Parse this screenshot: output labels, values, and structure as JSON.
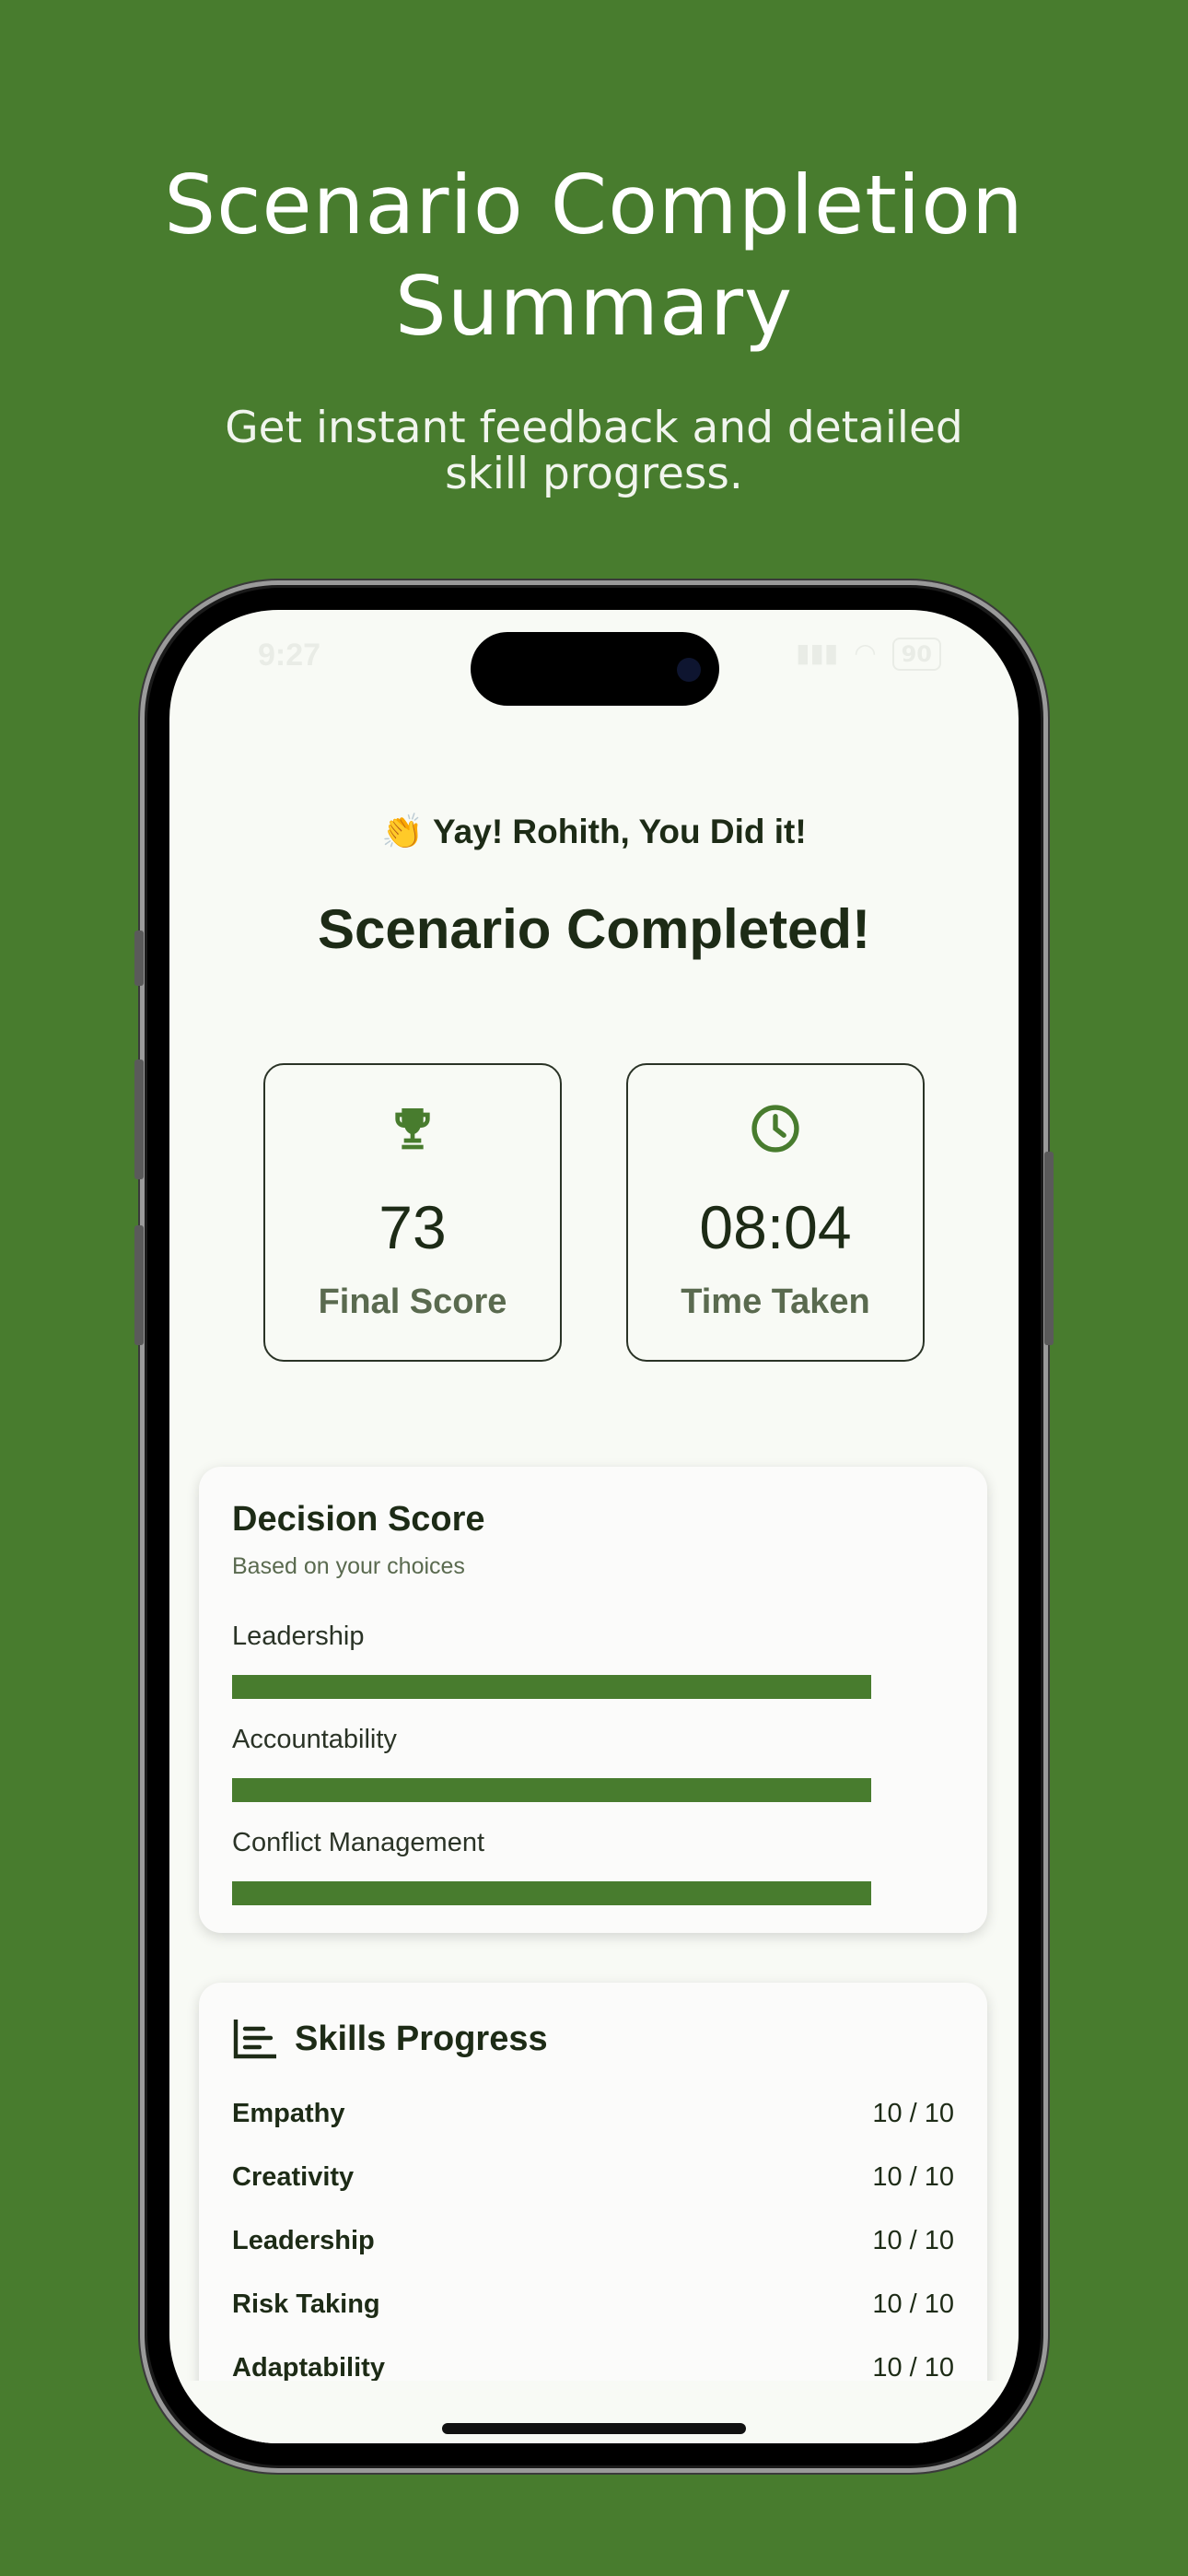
{
  "header": {
    "title_line1": "Scenario Completion",
    "title_line2": "Summary",
    "subtitle_line1": "Get instant feedback and detailed",
    "subtitle_line2": "skill progress."
  },
  "status_bar": {
    "time": "9:27",
    "battery": "90"
  },
  "completion": {
    "greeting_emoji": "👏",
    "greeting": "Yay!  Rohith, You Did it!",
    "title": "Scenario Completed!"
  },
  "stats": {
    "score": {
      "value": "73",
      "label": "Final Score",
      "icon": "trophy-icon"
    },
    "time": {
      "value": "08:04",
      "label": "Time Taken",
      "icon": "clock-icon"
    }
  },
  "decision_score": {
    "title": "Decision Score",
    "subtitle": "Based on your choices",
    "bars": [
      {
        "label": "Leadership",
        "value": 1.0
      },
      {
        "label": "Accountability",
        "value": 1.0
      },
      {
        "label": "Conflict Management",
        "value": 1.0
      }
    ]
  },
  "skills_progress": {
    "title": "Skills Progress",
    "icon": "bar-chart-icon",
    "items": [
      {
        "name": "Empathy",
        "score": "10 / 10"
      },
      {
        "name": "Creativity",
        "score": "10 / 10"
      },
      {
        "name": "Leadership",
        "score": "10 / 10"
      },
      {
        "name": "Risk Taking",
        "score": "10 / 10"
      },
      {
        "name": "Adaptability",
        "score": "10 / 10"
      }
    ]
  },
  "colors": {
    "background": "#487c2e",
    "accent": "#487c2e",
    "screen": "#f8faf5",
    "text_dark": "#1d2b16"
  }
}
